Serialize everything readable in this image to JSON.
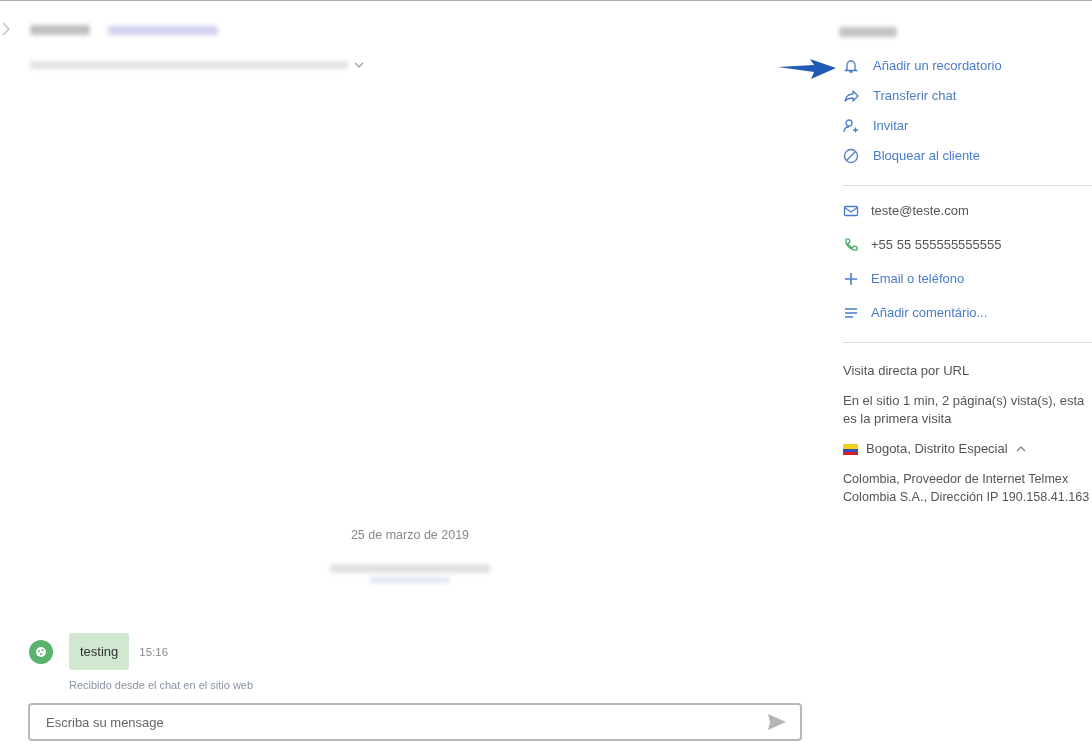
{
  "chat": {
    "date": "25 de marzo de 2019",
    "messages": [
      {
        "text": "testing",
        "time": "15:16",
        "source": "Recibido desde el chat en el sitio web"
      }
    ],
    "composer": {
      "placeholder": "Escriba su mensage"
    }
  },
  "sidebar": {
    "actions": [
      {
        "kind": "bell",
        "label": "Añadir un recordatorio"
      },
      {
        "kind": "share",
        "label": "Transferir chat"
      },
      {
        "kind": "person-add",
        "label": "Invitar"
      },
      {
        "kind": "block",
        "label": "Bloquear al cliente"
      }
    ],
    "contacts": [
      {
        "kind": "email",
        "text": "teste@teste.com",
        "link": false
      },
      {
        "kind": "phone",
        "text": "+55 55 555555555555",
        "link": false
      },
      {
        "kind": "plus",
        "text": "Email o teléfono",
        "link": true
      },
      {
        "kind": "lines",
        "text": "Añadir comentário...",
        "link": true
      }
    ],
    "visit": {
      "referrer": "Visita directa por URL",
      "summary": "En el sitio 1 min, 2 página(s) vista(s), esta es la primera visita",
      "location": "Bogota, Distrito Especial",
      "expanded": true,
      "details": [
        "Colombia, Proveedor de Internet Telmex",
        "Colombia S.A., Dirección IP 190.158.41.163"
      ]
    }
  }
}
